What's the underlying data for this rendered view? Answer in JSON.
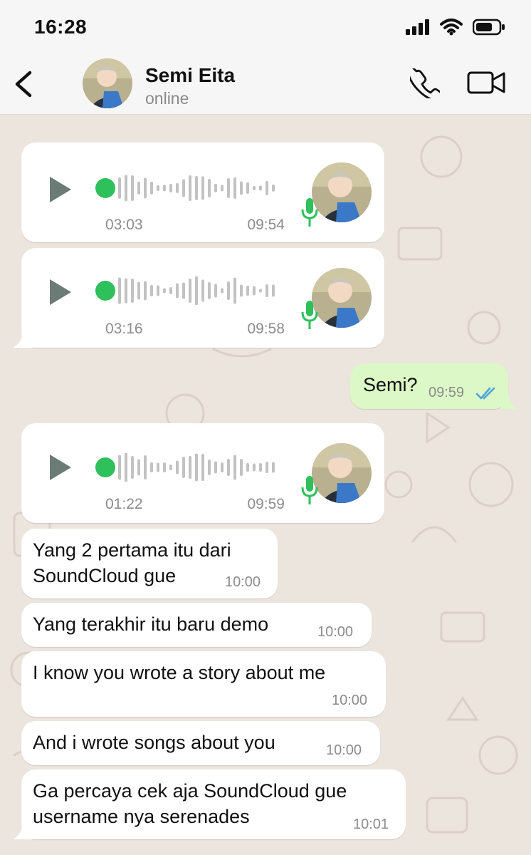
{
  "status_bar": {
    "time": "16:28"
  },
  "header": {
    "contact_name": "Semi Eita",
    "presence": "online"
  },
  "colors": {
    "chat_background": "#ece5dd",
    "incoming_bubble": "#ffffff",
    "outgoing_bubble": "#dcf8c6",
    "voice_accent": "#2ec05a",
    "read_ticks": "#4fa3e0"
  },
  "messages": [
    {
      "type": "voice",
      "direction": "in",
      "duration": "03:03",
      "time": "09:54"
    },
    {
      "type": "voice",
      "direction": "in",
      "duration": "03:16",
      "time": "09:58"
    },
    {
      "type": "text",
      "direction": "out",
      "text": "Semi?",
      "time": "09:59",
      "status": "read"
    },
    {
      "type": "voice",
      "direction": "in",
      "duration": "01:22",
      "time": "09:59"
    },
    {
      "type": "text",
      "direction": "in",
      "lines": [
        "Yang 2 pertama itu dari",
        "SoundCloud gue"
      ],
      "time": "10:00"
    },
    {
      "type": "text",
      "direction": "in",
      "lines": [
        "Yang terakhir itu baru demo"
      ],
      "time": "10:00"
    },
    {
      "type": "text",
      "direction": "in",
      "lines": [
        "I know you wrote a story about me"
      ],
      "time": "10:00"
    },
    {
      "type": "text",
      "direction": "in",
      "lines": [
        "And i wrote songs about you"
      ],
      "time": "10:00"
    },
    {
      "type": "text",
      "direction": "in",
      "lines": [
        "Ga percaya cek aja SoundCloud gue",
        "username nya serenades"
      ],
      "time": "10:01"
    }
  ],
  "icons": {
    "back": "chevron-left-icon",
    "call": "phone-icon",
    "video": "video-camera-icon",
    "play": "play-icon",
    "mic": "microphone-icon",
    "read": "double-check-icon"
  }
}
